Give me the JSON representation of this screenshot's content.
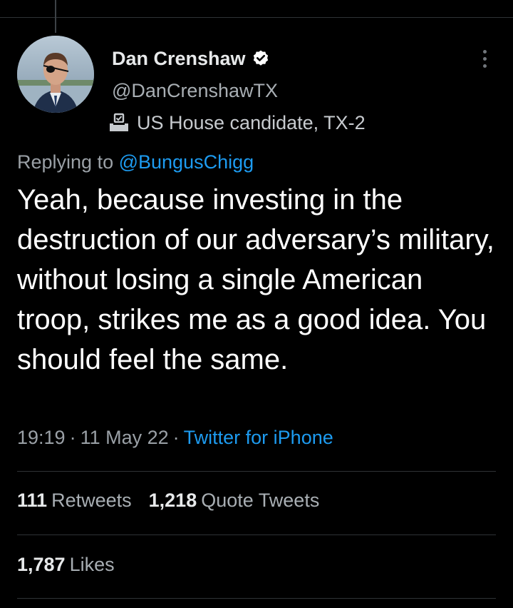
{
  "user": {
    "display_name": "Dan Crenshaw",
    "handle": "@DanCrenshawTX",
    "label": "US House candidate, TX-2",
    "verified": true
  },
  "reply": {
    "prefix": "Replying to",
    "mention": "@BungusChigg"
  },
  "tweet": {
    "text": "Yeah, because investing in the destruction of our adversary’s military, without losing a single American troop, strikes me as a good idea. You should feel the same.",
    "time": "19:19",
    "date": "11 May 22",
    "separator": "·",
    "source": "Twitter for iPhone"
  },
  "stats": {
    "retweets_count": "111",
    "retweets_label": "Retweets",
    "quotes_count": "1,218",
    "quotes_label": "Quote Tweets",
    "likes_count": "1,787",
    "likes_label": "Likes"
  },
  "colors": {
    "background": "#000000",
    "link": "#1d9bf0",
    "divider": "#2f3336"
  },
  "icons": {
    "verified": "verified-badge-icon",
    "label": "ballot-box-icon",
    "more": "more-vertical-icon"
  }
}
